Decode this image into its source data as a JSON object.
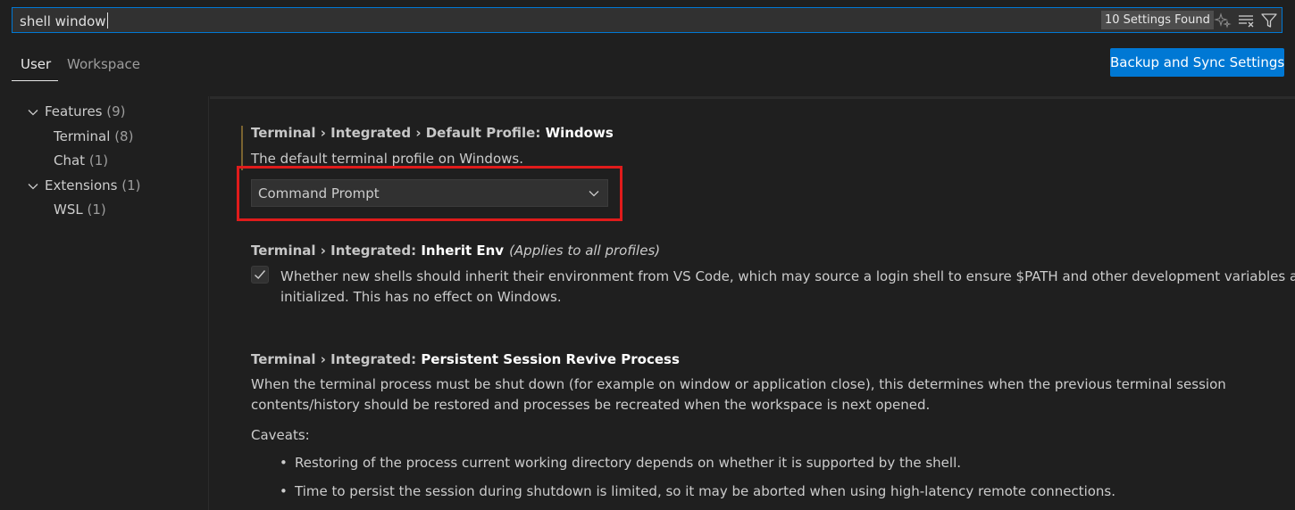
{
  "search": {
    "value": "shell window",
    "result_count": "10 Settings Found",
    "icons": [
      "sparkle-icon",
      "clear-filter-icon",
      "filter-icon"
    ]
  },
  "tabs": [
    {
      "label": "User",
      "active": true
    },
    {
      "label": "Workspace",
      "active": false
    }
  ],
  "sync_button": "Backup and Sync Settings",
  "toc": [
    {
      "label": "Features",
      "count": "(9)",
      "expanded": true
    },
    {
      "label": "Terminal",
      "count": "(8)"
    },
    {
      "label": "Chat",
      "count": "(1)"
    },
    {
      "label": "Extensions",
      "count": "(1)",
      "expanded": true
    },
    {
      "label": "WSL",
      "count": "(1)"
    }
  ],
  "settings": [
    {
      "category": "Terminal › Integrated › Default Profile: ",
      "name": "Windows",
      "description": "The default terminal profile on Windows.",
      "value": "Command Prompt"
    },
    {
      "category": "Terminal › Integrated: ",
      "name": "Inherit Env",
      "note": "(Applies to all profiles)",
      "description_line1": "Whether new shells should inherit their environment from VS Code, which may source a login shell to ensure $PATH and other development variables are",
      "description_line2": "initialized. This has no effect on Windows.",
      "checked": true
    },
    {
      "category": "Terminal › Integrated: ",
      "name": "Persistent Session Revive Process",
      "description_line1": "When the terminal process must be shut down (for example on window or application close), this determines when the previous terminal session",
      "description_line2": "contents/history should be restored and processes be recreated when the workspace is next opened.",
      "caveats_label": "Caveats:",
      "bullets": [
        "Restoring of the process current working directory depends on whether it is supported by the shell.",
        "Time to persist the session during shutdown is limited, so it may be aborted when using high-latency remote connections."
      ]
    }
  ],
  "colors": {
    "accent": "#0078d4",
    "highlight_box": "#e01b1b",
    "background": "#1f1f1f"
  }
}
